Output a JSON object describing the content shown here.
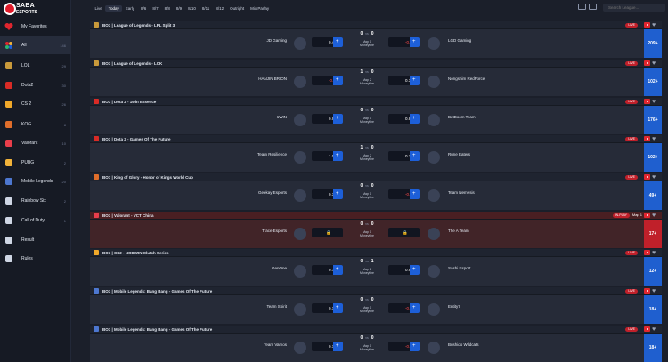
{
  "brand": {
    "line1": "SABA",
    "line2": "ESPORTS"
  },
  "sidebar": {
    "items": [
      {
        "label": "My Favorites",
        "count": "",
        "icon": "heart-icon",
        "color": "#e0262f"
      },
      {
        "label": "All",
        "count": "146",
        "icon": "grid-icon",
        "color": "#9aa3b5"
      },
      {
        "label": "LOL",
        "count": "29",
        "icon": "lol-icon",
        "color": "#c99a3b"
      },
      {
        "label": "Dota2",
        "count": "30",
        "icon": "dota2-icon",
        "color": "#d92b26"
      },
      {
        "label": "CS 2",
        "count": "26",
        "icon": "cs2-icon",
        "color": "#f0a82a"
      },
      {
        "label": "KOG",
        "count": "8",
        "icon": "kog-icon",
        "color": "#e06e2b"
      },
      {
        "label": "Valorant",
        "count": "10",
        "icon": "valorant-icon",
        "color": "#ea3e4b"
      },
      {
        "label": "PUBG",
        "count": "2",
        "icon": "pubg-icon",
        "color": "#f2b33a"
      },
      {
        "label": "Mobile Legends",
        "count": "20",
        "icon": "mobile-legends-icon",
        "color": "#4d77d0"
      },
      {
        "label": "Rainbow Six",
        "count": "2",
        "icon": "rainbow-six-icon",
        "color": "#cfd6e4"
      },
      {
        "label": "Call of Duty",
        "count": "1",
        "icon": "call-of-duty-icon",
        "color": "#cfd6e4"
      },
      {
        "label": "Result",
        "count": "",
        "icon": "result-icon",
        "color": "#cfd6e4"
      },
      {
        "label": "Rules",
        "count": "",
        "icon": "rules-icon",
        "color": "#cfd6e4"
      }
    ]
  },
  "tabs": [
    "Live",
    "Today",
    "Early",
    "8/6",
    "8/7",
    "8/8",
    "8/9",
    "8/10",
    "8/11",
    "8/12",
    "Outright",
    "Mix Parlay"
  ],
  "active_tab": 1,
  "search": {
    "placeholder": "Search League..."
  },
  "matches": [
    {
      "game": "lol",
      "header": "BO3 | League of Legends - LPL Split 3",
      "live_badge": "LIVE",
      "team1": "JD Gaming",
      "odd1": "0.46",
      "odd1_red": false,
      "score1": "0",
      "score2": "0",
      "map": "Map 1",
      "market": "Moneyline",
      "odd2": "-0.61",
      "odd2_red": true,
      "team2": "LGD Gaming",
      "more": "209+",
      "locked": false
    },
    {
      "game": "lol",
      "header": "BO3 | League of Legends - LCK",
      "live_badge": "LIVE",
      "team1": "HANJIN BRION",
      "odd1": "-0.52",
      "odd1_red": true,
      "score1": "1",
      "score2": "0",
      "map": "Map 2",
      "market": "Moneyline",
      "odd2": "0.39",
      "odd2_red": false,
      "team2": "Nongshim RedForce",
      "more": "102+",
      "locked": false
    },
    {
      "game": "dota",
      "header": "BO3 | Dota 2 - 1win Essence",
      "live_badge": "LIVE",
      "team1": "1WIN",
      "odd1": "0.92",
      "odd1_red": false,
      "score1": "0",
      "score2": "0",
      "map": "Map 1",
      "market": "Moneyline",
      "odd2": "0.84",
      "odd2_red": false,
      "team2": "BetBoom Team",
      "more": "176+",
      "locked": false
    },
    {
      "game": "dota",
      "header": "BO3 | Dota 2 - Games Of The Future",
      "live_badge": "LIVE",
      "team1": "Team Resilience",
      "odd1": "1.00",
      "odd1_red": false,
      "score1": "1",
      "score2": "0",
      "map": "Map 2",
      "market": "Moneyline",
      "odd2": "0.77",
      "odd2_red": false,
      "team2": "Rune Eaters",
      "more": "102+",
      "locked": false
    },
    {
      "game": "kog",
      "header": "BO7 | King of Glory - Honor of Kings World Cup",
      "live_badge": "LIVE",
      "team1": "Geekay Esports",
      "odd1": "0.30",
      "odd1_red": false,
      "score1": "0",
      "score2": "0",
      "map": "Map 1",
      "market": "Moneyline",
      "odd2": "-0.42",
      "odd2_red": true,
      "team2": "Team Nemesis",
      "more": "49+",
      "locked": false
    },
    {
      "game": "valorant",
      "header": "BO3 | Valorant - VCT China",
      "live_badge": "IN-PLAY",
      "live_map": "Map 1",
      "team1": "Trace Esports",
      "odd1": "",
      "odd1_red": false,
      "score1": "0",
      "score2": "0",
      "map": "Map 1",
      "market": "Moneyline",
      "odd2": "",
      "odd2_red": false,
      "team2": "The A Team",
      "more": "17+",
      "locked": true
    },
    {
      "game": "cs2",
      "header": "BO3 | CS2 - NODWIN Clutch Series",
      "live_badge": "LIVE",
      "team1": "GenOne",
      "odd1": "0.75",
      "odd1_red": false,
      "score1": "0",
      "score2": "1",
      "map": "Map 2",
      "market": "Moneyline",
      "odd2": "0.97",
      "odd2_red": false,
      "team2": "Sashi Esport",
      "more": "12+",
      "locked": false
    },
    {
      "game": "ml",
      "header": "BO3 | Mobile Legends: Bang Bang - Games Of The Future",
      "live_badge": "LIVE",
      "team1": "Team Spirit",
      "odd1": "0.16",
      "odd1_red": false,
      "score1": "0",
      "score2": "0",
      "map": "Map 1",
      "market": "Moneyline",
      "odd2": "-0.26",
      "odd2_red": true,
      "team2": "Entity7",
      "more": "18+",
      "locked": false
    },
    {
      "game": "ml",
      "header": "BO3 | Mobile Legends: Bang Bang - Games Of The Future",
      "live_badge": "LIVE",
      "team1": "Team Vamos",
      "odd1": "0.14",
      "odd1_red": false,
      "score1": "0",
      "score2": "0",
      "map": "Map 1",
      "market": "Moneyline",
      "odd2": "-0.23",
      "odd2_red": true,
      "team2": "Bushido Wildcats",
      "more": "18+",
      "locked": false
    }
  ]
}
